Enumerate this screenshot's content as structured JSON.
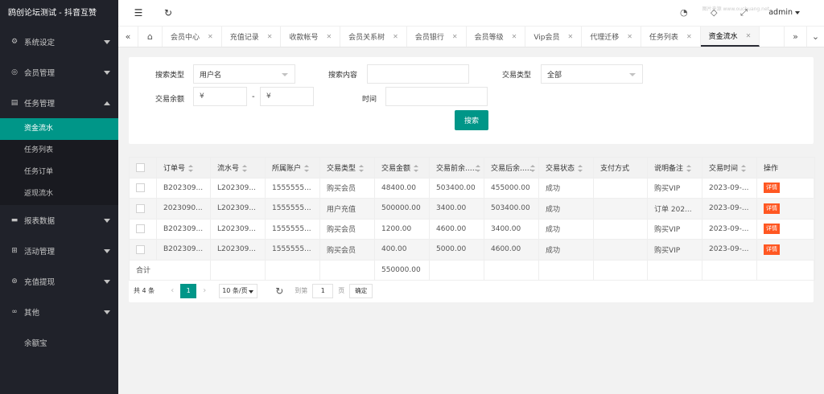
{
  "brand": "鸥创论坛测试 - 抖音互赞",
  "sidebar": {
    "groups": [
      {
        "label": "系统设定",
        "icon": "gear-icon"
      },
      {
        "label": "会员管理",
        "icon": "user-icon"
      },
      {
        "label": "任务管理",
        "icon": "list-icon"
      },
      {
        "label": "报表数据",
        "icon": "chat-icon"
      },
      {
        "label": "活动管理",
        "icon": "game-icon"
      },
      {
        "label": "充值提现",
        "icon": "money-icon"
      },
      {
        "label": "其他",
        "icon": "link-icon"
      },
      {
        "label": "余额宝",
        "icon": ""
      }
    ],
    "task_sub": [
      "资金流水",
      "任务列表",
      "任务订单",
      "返现流水"
    ]
  },
  "topbar": {
    "user": "admin",
    "watermark": "图片来源 www.ouchuang.net"
  },
  "tabs": [
    "会员中心",
    "充值记录",
    "收款帐号",
    "会员关系树",
    "会员银行",
    "会员等级",
    "Vip会员",
    "代理迁移",
    "任务列表",
    "资金流水"
  ],
  "search": {
    "type_label": "搜索类型",
    "type_value": "用户名",
    "content_label": "搜索内容",
    "content_value": "",
    "trade_label": "交易类型",
    "trade_value": "全部",
    "balance_label": "交易余额",
    "min_placeholder": "¥",
    "dash": "-",
    "max_placeholder": "¥",
    "time_label": "时间",
    "time_value": "",
    "button": "搜索"
  },
  "table": {
    "headers": [
      "订单号",
      "流水号",
      "所属账户",
      "交易类型",
      "交易金额",
      "交易前余...",
      "交易后余...",
      "交易状态",
      "支付方式",
      "说明备注",
      "交易时间",
      "操作"
    ],
    "rows": [
      [
        "B202309...",
        "L202309...",
        "1555555...",
        "购买会员",
        "48400.00",
        "503400.00",
        "455000.00",
        "成功",
        "",
        "购买VIP",
        "2023-09-...",
        "详情"
      ],
      [
        "2023090...",
        "L202309...",
        "1555555...",
        "用户充值",
        "500000.00",
        "3400.00",
        "503400.00",
        "成功",
        "",
        "订单 202...",
        "2023-09-...",
        "详情"
      ],
      [
        "B202309...",
        "L202309...",
        "1555555...",
        "购买会员",
        "1200.00",
        "4600.00",
        "3400.00",
        "成功",
        "",
        "购买VIP",
        "2023-09-...",
        "详情"
      ],
      [
        "B202309...",
        "L202309...",
        "1555555...",
        "购买会员",
        "400.00",
        "5000.00",
        "4600.00",
        "成功",
        "",
        "购买VIP",
        "2023-09-...",
        "详情"
      ]
    ],
    "total_label": "合计",
    "total_amount": "550000.00"
  },
  "pager": {
    "total": "共 4 条",
    "current": "1",
    "page_size": "10 条/页",
    "goto": "到第",
    "goto_value": "1",
    "page_unit": "页",
    "ok": "确定"
  },
  "colors": {
    "sidebar_bg": "#20222a",
    "accent": "#009688",
    "danger": "#ff5722"
  }
}
